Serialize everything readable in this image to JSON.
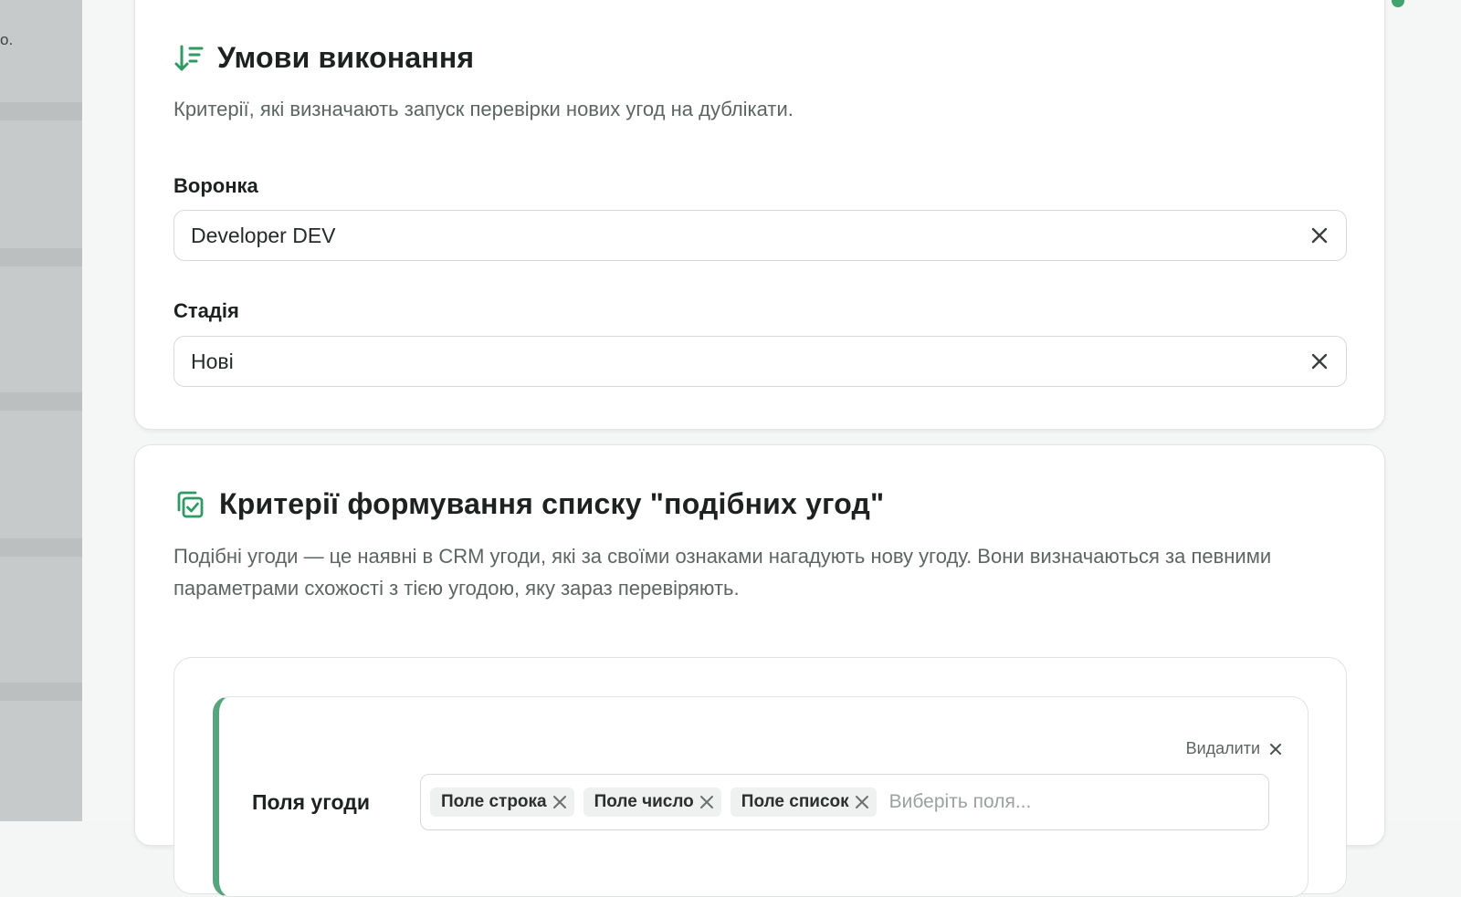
{
  "sidebar": {
    "cut_text": "o."
  },
  "execution_conditions": {
    "title": "Умови виконання",
    "icon": "sort-descending-icon",
    "description": "Критерії, які визначають запуск перевірки нових угод на дублікати.",
    "funnel": {
      "label": "Воронка",
      "value": "Developer DEV"
    },
    "stage": {
      "label": "Стадія",
      "value": "Нові"
    }
  },
  "similar_deals": {
    "title": "Критерії формування списку \"подібних угод\"",
    "icon": "copy-check-icon",
    "description": "Подібні угоди — це наявні в CRM угоди, які за своїми ознаками нагадують нову угоду. Вони визначаються за певними параметрами схожості з тією угодою, яку зараз перевіряють.",
    "criteria": {
      "remove_label": "Видалити",
      "fields_label": "Поля угоди",
      "chips": [
        "Поле строка",
        "Поле число",
        "Поле список"
      ],
      "placeholder": "Виберіть поля..."
    }
  },
  "colors": {
    "accent": "#3fa46e",
    "criteria_border": "#56a57f"
  }
}
